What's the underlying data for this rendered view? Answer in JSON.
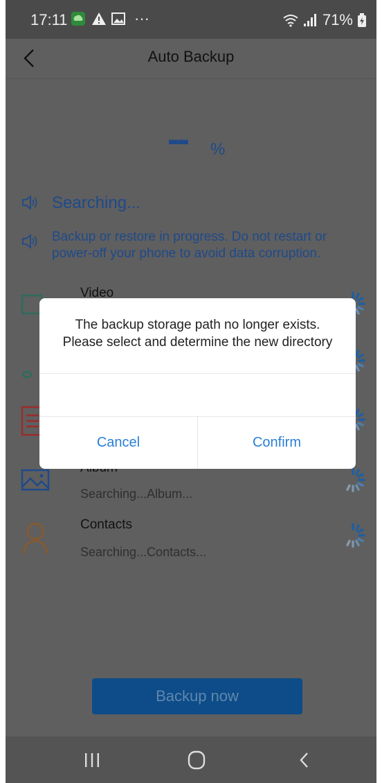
{
  "status_bar": {
    "time": "17:11",
    "notification_icons": [
      "cloud-app-icon",
      "warning-icon",
      "image-icon",
      "more-icon"
    ],
    "more_indicator": "···",
    "battery_percent": "71%",
    "status_icons": [
      "wifi-icon",
      "signal-icon",
      "battery-icon"
    ]
  },
  "header": {
    "title": "Auto Backup",
    "back_icon": "back-arrow-icon"
  },
  "progress": {
    "value": "--",
    "unit": "%"
  },
  "messages": {
    "searching": "Searching...",
    "warning": "Backup or restore in progress. Do not restart or power-off your phone to avoid data corruption."
  },
  "items": [
    {
      "title": "Video",
      "subtitle": "",
      "icon": "video-icon",
      "icon_color": "#2f6b5d"
    },
    {
      "title": "",
      "subtitle": "",
      "icon": "music-icon",
      "icon_color": "#2f6b5d"
    },
    {
      "title": "",
      "subtitle": "",
      "icon": "document-icon",
      "icon_color": "#9a2c2c"
    },
    {
      "title": "Album",
      "subtitle": "Searching...Album...",
      "icon": "album-icon",
      "icon_color": "#1f4a8a"
    },
    {
      "title": "Contacts",
      "subtitle": "Searching...Contacts...",
      "icon": "contacts-icon",
      "icon_color": "#8a5a2a"
    }
  ],
  "backup_button": {
    "label": "Backup now"
  },
  "dialog": {
    "message": "The backup storage path no longer exists. Please select and determine the new directory",
    "cancel_label": "Cancel",
    "confirm_label": "Confirm",
    "button_color": "#2a7fd4"
  },
  "nav_bar": {
    "buttons": [
      "recent-apps-icon",
      "home-icon",
      "back-icon"
    ]
  }
}
